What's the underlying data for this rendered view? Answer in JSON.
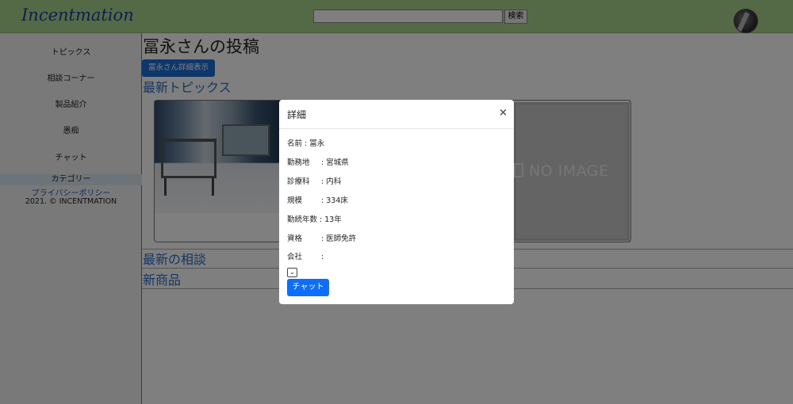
{
  "header": {
    "logo": "Incentmation",
    "search_placeholder": "",
    "search_button": "検索"
  },
  "sidebar": {
    "items": [
      {
        "label": "トピックス"
      },
      {
        "label": "相談コーナー"
      },
      {
        "label": "製品紹介"
      },
      {
        "label": "愚痴"
      },
      {
        "label": "チャット"
      }
    ],
    "category": "カテゴリー",
    "privacy": "プライバシーポリシー",
    "copyright": "2021. © INCENTMATION"
  },
  "main": {
    "title": "冨永さんの投稿",
    "detail_button": "冨永さん詳細表示",
    "sections": {
      "topics": "最新トピックス",
      "consult": "最新の相談",
      "products": "新商品"
    },
    "no_image": "NO IMAGE"
  },
  "modal": {
    "title": "詳細",
    "close": "×",
    "fields": {
      "name": {
        "label": "名前",
        "value": ": 冨永"
      },
      "workplace": {
        "label": "勤務地",
        "value": ": 宮城県"
      },
      "department": {
        "label": "診療科",
        "value": ": 内科"
      },
      "scale": {
        "label": "規模",
        "value": ": 334床"
      },
      "years": {
        "label": "勤続年数",
        "value": ": 13年"
      },
      "license": {
        "label": "資格",
        "value": ": 医師免許"
      },
      "company": {
        "label": "会社",
        "value": ":"
      }
    },
    "select_glyph": "⌄",
    "chat_button": "チャット"
  }
}
